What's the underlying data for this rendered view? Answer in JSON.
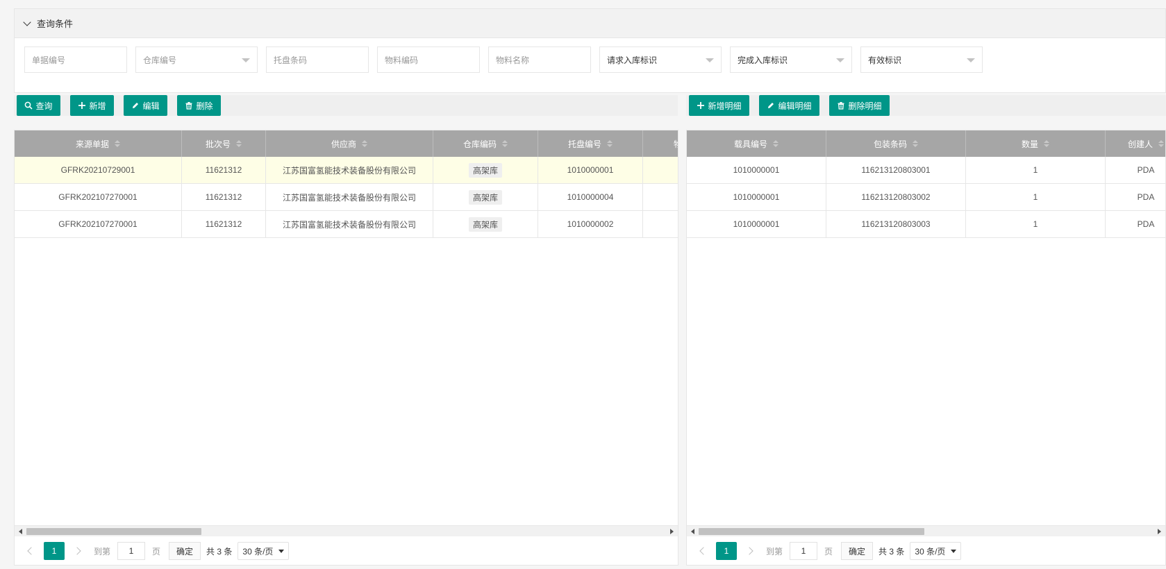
{
  "query": {
    "title": "查询条件",
    "fields": [
      {
        "placeholder": "单据编号"
      },
      {
        "placeholder": "仓库编号"
      },
      {
        "placeholder": "托盘条码"
      },
      {
        "placeholder": "物料编码"
      },
      {
        "placeholder": "物料名称"
      },
      {
        "placeholder": "请求入库标识"
      },
      {
        "placeholder": "完成入库标识"
      },
      {
        "placeholder": "有效标识"
      }
    ]
  },
  "left_toolbar": {
    "query_label": "查询",
    "add_label": "新增",
    "edit_label": "编辑",
    "delete_label": "删除"
  },
  "right_toolbar": {
    "add_detail_label": "新增明细",
    "edit_detail_label": "编辑明细",
    "delete_detail_label": "删除明细"
  },
  "left_table": {
    "columns": [
      "来源单据",
      "批次号",
      "供应商",
      "仓库编码",
      "托盘编号",
      "物"
    ],
    "rows": [
      [
        "GFRK20210729001",
        "11621312",
        "江苏国富氢能技术装备股份有限公司",
        "高架库",
        "1010000001",
        ""
      ],
      [
        "GFRK202107270001",
        "11621312",
        "江苏国富氢能技术装备股份有限公司",
        "高架库",
        "1010000004",
        ""
      ],
      [
        "GFRK202107270001",
        "11621312",
        "江苏国富氢能技术装备股份有限公司",
        "高架库",
        "1010000002",
        ""
      ]
    ]
  },
  "right_table": {
    "columns": [
      "载具编号",
      "包装条码",
      "数量",
      "创建人"
    ],
    "rows": [
      [
        "1010000001",
        "116213120803001",
        "1",
        "PDA"
      ],
      [
        "1010000001",
        "116213120803002",
        "1",
        "PDA"
      ],
      [
        "1010000001",
        "116213120803003",
        "1",
        "PDA"
      ]
    ]
  },
  "pager": {
    "current_page": "1",
    "goto_label": "到第",
    "goto_value": "1",
    "page_unit": "页",
    "confirm_label": "确定",
    "total_label": "共 3 条",
    "page_size": "30 条/页"
  },
  "colors": {
    "primary": "#009688",
    "header_bg": "#a6a6a6",
    "highlight_row": "#fefee6"
  }
}
